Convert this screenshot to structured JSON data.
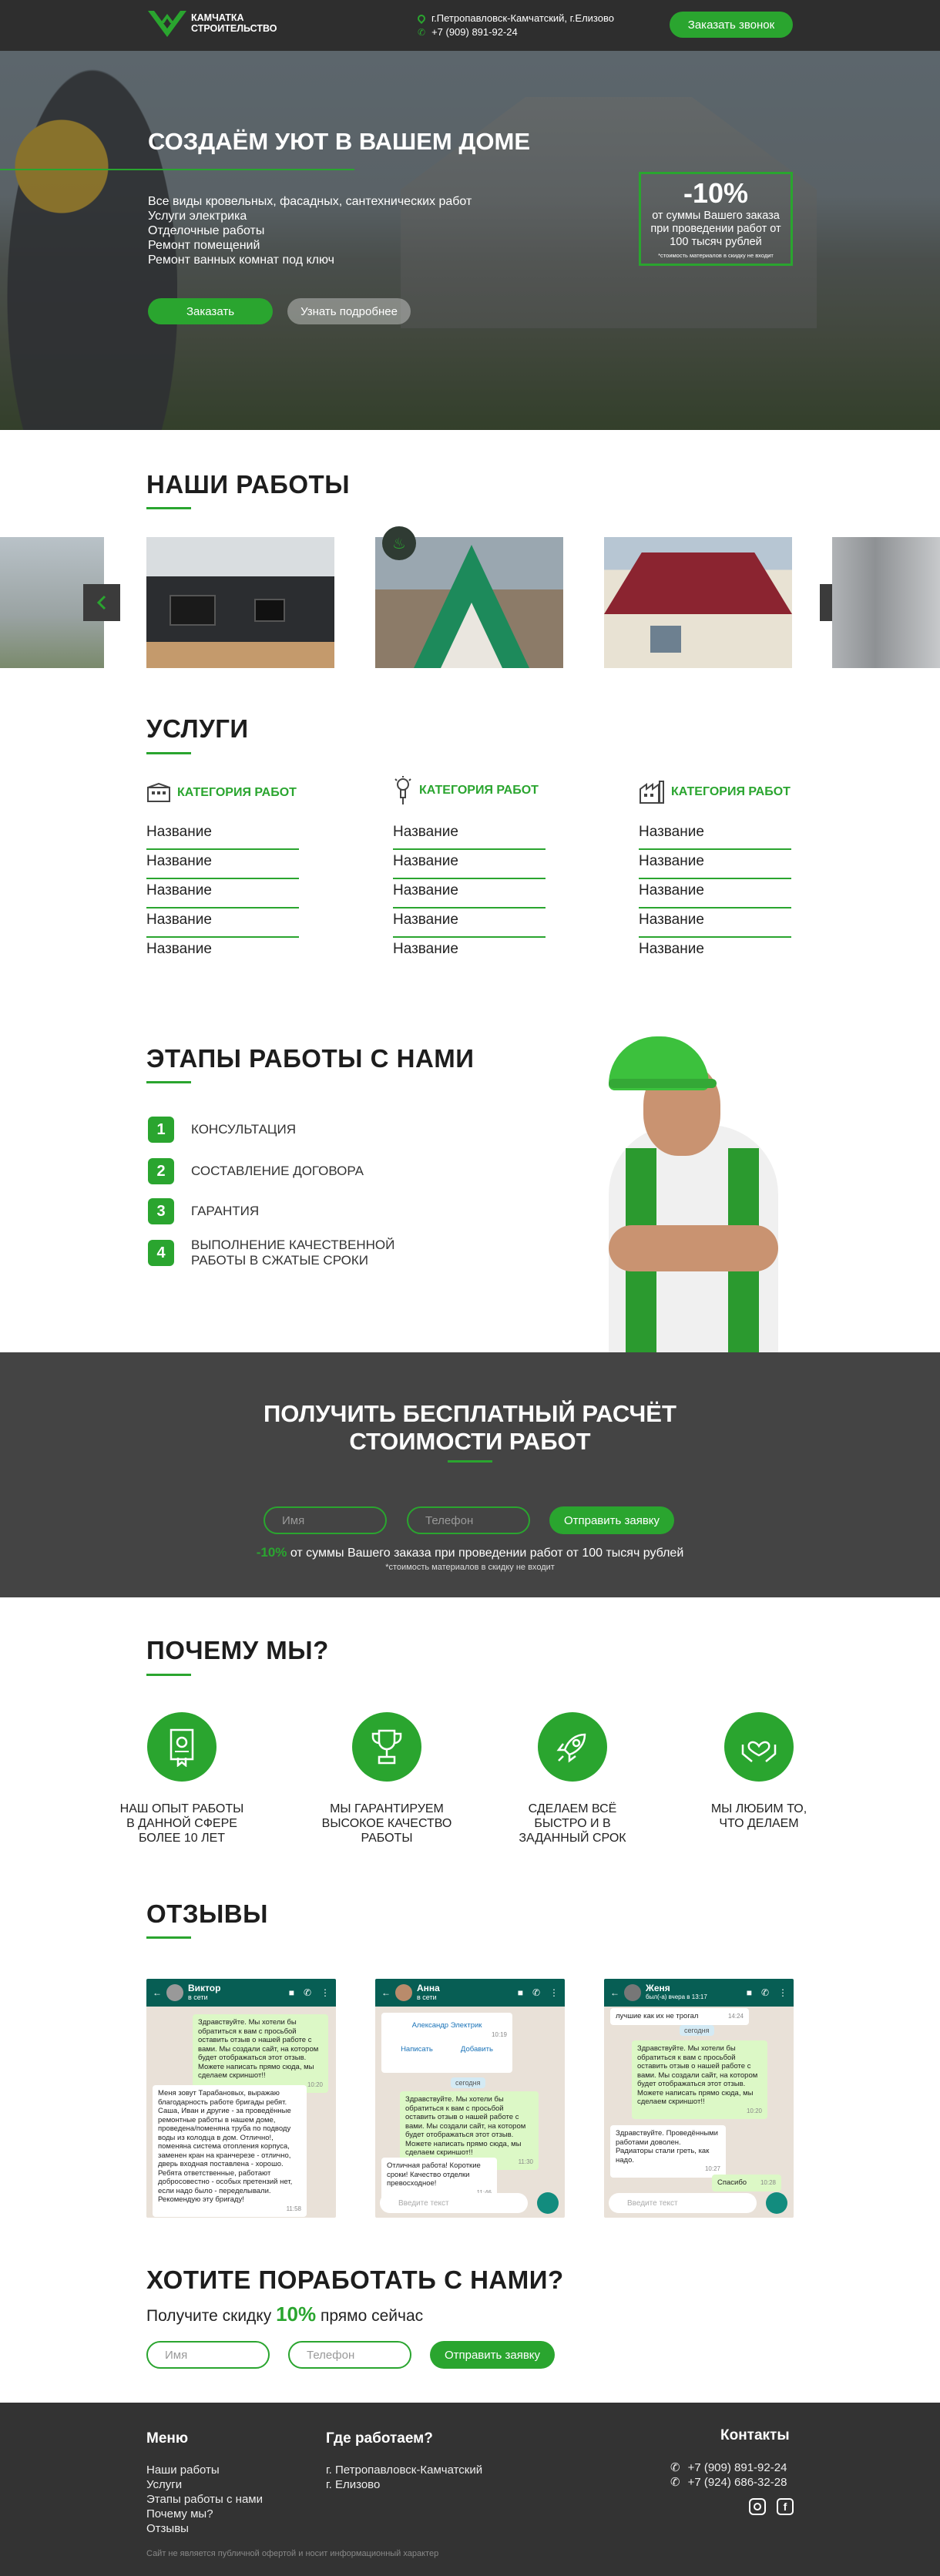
{
  "header": {
    "logo_line1": "КАМЧАТКА",
    "logo_line2": "СТРОИТЕЛЬСТВО",
    "address": "г.Петропавловск-Камчатский, г.Елизово",
    "phone": "+7 (909) 891-92-24",
    "call_button": "Заказать звонок"
  },
  "hero": {
    "title": "СОЗДАЁМ УЮТ В ВАШЕМ ДОМЕ",
    "list": [
      "Все виды кровельных, фасадных, сантехнических работ",
      "Услуги электрика",
      "Отделочные работы",
      "Ремонт помещений",
      "Ремонт ванных комнат под ключ"
    ],
    "order_button": "Заказать",
    "more_button": "Узнать подробнее",
    "promo_value": "-10%",
    "promo_text": "от суммы Вашего заказа при проведении работ от 100 тысяч рублей",
    "promo_note": "*стоимость материалов в скидку не входит"
  },
  "works": {
    "title": "НАШИ РАБОТЫ"
  },
  "services": {
    "title": "УСЛУГИ",
    "columns": [
      {
        "category": "КАТЕГОРИЯ РАБОТ",
        "icon": "building-icon",
        "items": [
          "Название",
          "Название",
          "Название",
          "Название",
          "Название"
        ]
      },
      {
        "category": "КАТЕГОРИЯ РАБОТ",
        "icon": "lightbulb-icon",
        "items": [
          "Название",
          "Название",
          "Название",
          "Название",
          "Название"
        ]
      },
      {
        "category": "КАТЕГОРИЯ РАБОТ",
        "icon": "factory-icon",
        "items": [
          "Название",
          "Название",
          "Название",
          "Название",
          "Название"
        ]
      }
    ]
  },
  "steps": {
    "title": "ЭТАПЫ РАБОТЫ С НАМИ",
    "items": [
      {
        "num": "1",
        "text": "КОНСУЛЬТАЦИЯ"
      },
      {
        "num": "2",
        "text": "СОСТАВЛЕНИЕ ДОГОВОРА"
      },
      {
        "num": "3",
        "text": "ГАРАНТИЯ"
      },
      {
        "num": "4",
        "text": "ВЫПОЛНЕНИЕ КАЧЕСТВЕННОЙ РАБОТЫ В СЖАТЫЕ СРОКИ"
      }
    ]
  },
  "calc": {
    "title_line1": "ПОЛУЧИТЬ БЕСПЛАТНЫЙ РАСЧЁТ",
    "title_line2": "СТОИМОСТИ РАБОТ",
    "name_placeholder": "Имя",
    "phone_placeholder": "Телефон",
    "submit": "Отправить заявку",
    "promo_value": "-10%",
    "promo_text": "от суммы Вашего заказа при проведении работ от 100 тысяч рублей",
    "promo_note": "*стоимость материалов в скидку не входит"
  },
  "why": {
    "title": "ПОЧЕМУ МЫ?",
    "items": [
      {
        "icon": "certificate-icon",
        "text": "НАШ ОПЫТ РАБОТЫ В ДАННОЙ СФЕРЕ БОЛЕЕ 10 ЛЕТ"
      },
      {
        "icon": "trophy-icon",
        "text": "МЫ ГАРАНТИРУЕМ ВЫСОКОЕ КАЧЕСТВО РАБОТЫ"
      },
      {
        "icon": "rocket-icon",
        "text": "СДЕЛАЕМ ВСЁ БЫСТРО И В ЗАДАННЫЙ СРОК"
      },
      {
        "icon": "heart-hands-icon",
        "text": "МЫ ЛЮБИМ ТО, ЧТО ДЕЛАЕМ"
      }
    ]
  },
  "reviews": {
    "title": "ОТЗЫВЫ",
    "chats": [
      {
        "name": "Виктор",
        "status": "в сети",
        "out": "Здравствуйте. Мы хотели бы обратиться к вам с просьбой оставить отзыв о нашей работе с вами. Мы создали сайт, на котором будет отображаться этот отзыв. Можете написать прямо сюда, мы сделаем скриншот!!",
        "out_time": "10:20",
        "in": "Меня зовут Тарабановых, выражаю благодарность работе бригады ребят. Саша, Иван и другие - за проведённые ремонтные работы в нашем доме, проведена/поменяна труба по подводу воды из колодца в дом. Отлично!, поменяна система отопления корпуса, заменен кран на кранчерезе - отлично, дверь входная поставлена - хорошо. Ребята ответственные, работают добросовестно - особых претензий нет, если надо было - переделывали. Рекомендую эту бригаду!",
        "in_time": "11:58",
        "input": "Введите текст"
      },
      {
        "name": "Анна",
        "status": "в сети",
        "contact_name": "Александр Электрик",
        "contact_time": "10:19",
        "write": "Написать",
        "add": "Добавить",
        "date": "сегодня",
        "out": "Здравствуйте. Мы хотели бы обратиться к вам с просьбой оставить отзыв о нашей работе с вами. Мы создали сайт, на котором будет отображаться этот отзыв. Можете написать прямо сюда, мы сделаем скриншот!!",
        "out_time": "11:30",
        "in": "Отличная работа! Короткие сроки! Качество отделки превосходное!",
        "in_time": "11:46",
        "input": "Введите текст"
      },
      {
        "name": "Женя",
        "status": "был(-а) вчера в 13:17",
        "top": "лучшие как их не трогал",
        "top_time": "14:24",
        "date": "сегодня",
        "out": "Здравствуйте. Мы хотели бы обратиться к вам с просьбой оставить отзыв о нашей работе с вами. Мы создали сайт, на котором будет отображаться этот отзыв. Можете написать прямо сюда, мы сделаем скриншот!!",
        "out_time": "10:20",
        "in": "Здравствуйте. Проведёнными работами доволен. Радиаторы стали греть, как надо.",
        "in_time": "10:27",
        "thanks": "Спасибо",
        "thanks_time": "10:28",
        "input": "Введите текст"
      }
    ]
  },
  "cta": {
    "title": "ХОТИТЕ ПОРАБОТАТЬ С НАМИ?",
    "sub_before": "Получите скидку",
    "sub_value": "10%",
    "sub_after": "прямо сейчас",
    "name_placeholder": "Имя",
    "phone_placeholder": "Телефон",
    "submit": "Отправить заявку"
  },
  "footer": {
    "menu_title": "Меню",
    "menu": [
      "Наши работы",
      "Услуги",
      "Этапы работы с нами",
      "Почему мы?",
      "Отзывы"
    ],
    "where_title": "Где работаем?",
    "where": [
      "г. Петропавловск-Камчатский",
      "г. Елизово"
    ],
    "contacts_title": "Контакты",
    "phones": [
      "+7 (909) 891-92-24",
      "+7 (924) 686-32-28"
    ],
    "disclaimer": "Сайт не является публичной офертой и носит информационный характер"
  },
  "colors": {
    "accent": "#2aa52f",
    "dark": "#333333",
    "header": "#2e2e2e"
  }
}
